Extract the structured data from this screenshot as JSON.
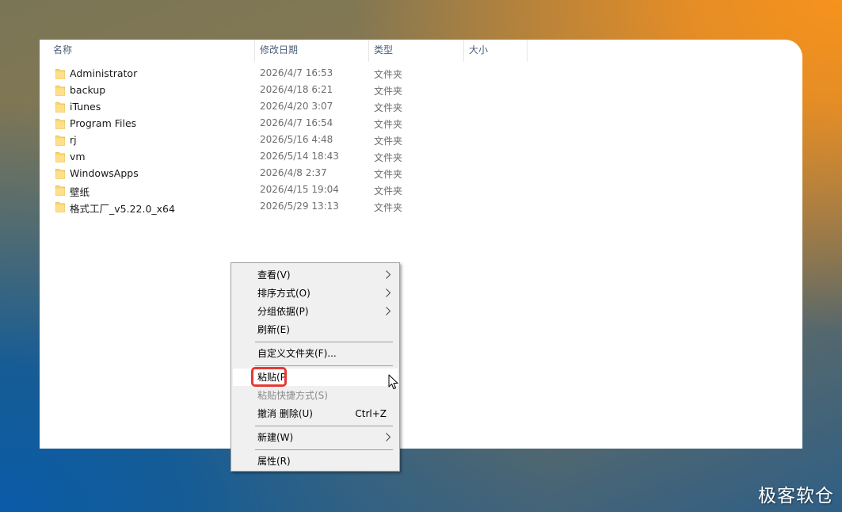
{
  "columns": {
    "name": "名称",
    "modified": "修改日期",
    "type": "类型",
    "size": "大小"
  },
  "files": [
    {
      "name": "Administrator",
      "modified": "2026/4/7 16:53",
      "type": "文件夹"
    },
    {
      "name": "backup",
      "modified": "2026/4/18 6:21",
      "type": "文件夹"
    },
    {
      "name": "iTunes",
      "modified": "2026/4/20 3:07",
      "type": "文件夹"
    },
    {
      "name": "Program Files",
      "modified": "2026/4/7 16:54",
      "type": "文件夹"
    },
    {
      "name": "rj",
      "modified": "2026/5/16 4:48",
      "type": "文件夹"
    },
    {
      "name": "vm",
      "modified": "2026/5/14 18:43",
      "type": "文件夹"
    },
    {
      "name": "WindowsApps",
      "modified": "2026/4/8 2:37",
      "type": "文件夹"
    },
    {
      "name": "壁纸",
      "modified": "2026/4/15 19:04",
      "type": "文件夹"
    },
    {
      "name": "格式工厂_v5.22.0_x64",
      "modified": "2026/5/29 13:13",
      "type": "文件夹"
    }
  ],
  "context_menu": {
    "view": "查看(V)",
    "sort_by": "排序方式(O)",
    "group_by": "分组依据(P)",
    "refresh": "刷新(E)",
    "customize_folder": "自定义文件夹(F)...",
    "paste": "粘贴(P",
    "paste_shortcut": "粘贴快捷方式(S)",
    "undo_delete": "撤消 删除(U)",
    "undo_shortcut": "Ctrl+Z",
    "new": "新建(W)",
    "properties": "属性(R)"
  },
  "colors": {
    "folder_yellow": "#ffd866",
    "highlight_red": "#e53935"
  },
  "icons": {
    "folder": "folder-icon",
    "submenu": "chevron-right-icon",
    "cursor": "mouse-pointer-icon",
    "sort": "sort-up-icon"
  },
  "watermark": "极客软仓"
}
